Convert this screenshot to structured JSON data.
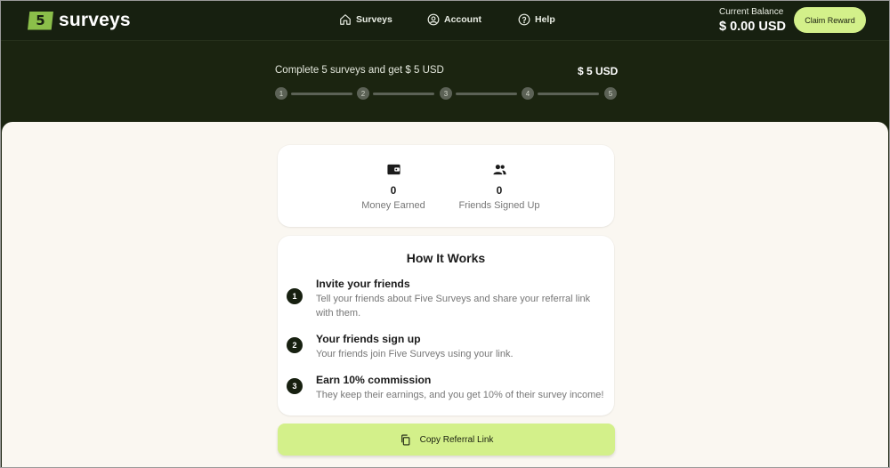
{
  "brand": {
    "badge": "5",
    "name": "surveys"
  },
  "nav": {
    "items": [
      {
        "label": "Surveys",
        "icon": "home-icon"
      },
      {
        "label": "Account",
        "icon": "user-circle-icon"
      },
      {
        "label": "Help",
        "icon": "help-circle-icon"
      }
    ]
  },
  "balance": {
    "label": "Current Balance",
    "value": "$ 0.00 USD"
  },
  "claim_button": "Claim Reward",
  "progress": {
    "text": "Complete 5 surveys and get $ 5 USD",
    "amount": "$ 5 USD",
    "steps": [
      "1",
      "2",
      "3",
      "4",
      "5"
    ],
    "completed": 0
  },
  "stats": {
    "money": {
      "value": "0",
      "label": "Money Earned",
      "icon": "wallet-icon"
    },
    "friends": {
      "value": "0",
      "label": "Friends Signed Up",
      "icon": "users-icon"
    }
  },
  "how_it_works": {
    "title": "How It Works",
    "steps": [
      {
        "num": "1",
        "title": "Invite your friends",
        "desc": "Tell your friends about Five Surveys and share your referral link with them."
      },
      {
        "num": "2",
        "title": "Your friends sign up",
        "desc": "Your friends join Five Surveys using your link."
      },
      {
        "num": "3",
        "title": "Earn 10% commission",
        "desc": "They keep their earnings, and you get 10% of their survey income!"
      }
    ]
  },
  "copy_button": {
    "label": "Copy Referral Link",
    "icon": "copy-icon"
  },
  "colors": {
    "dark": "#172010",
    "accent": "#d3f08a",
    "logo_green": "#8bbf4a",
    "page_bg": "#faf7f1"
  }
}
